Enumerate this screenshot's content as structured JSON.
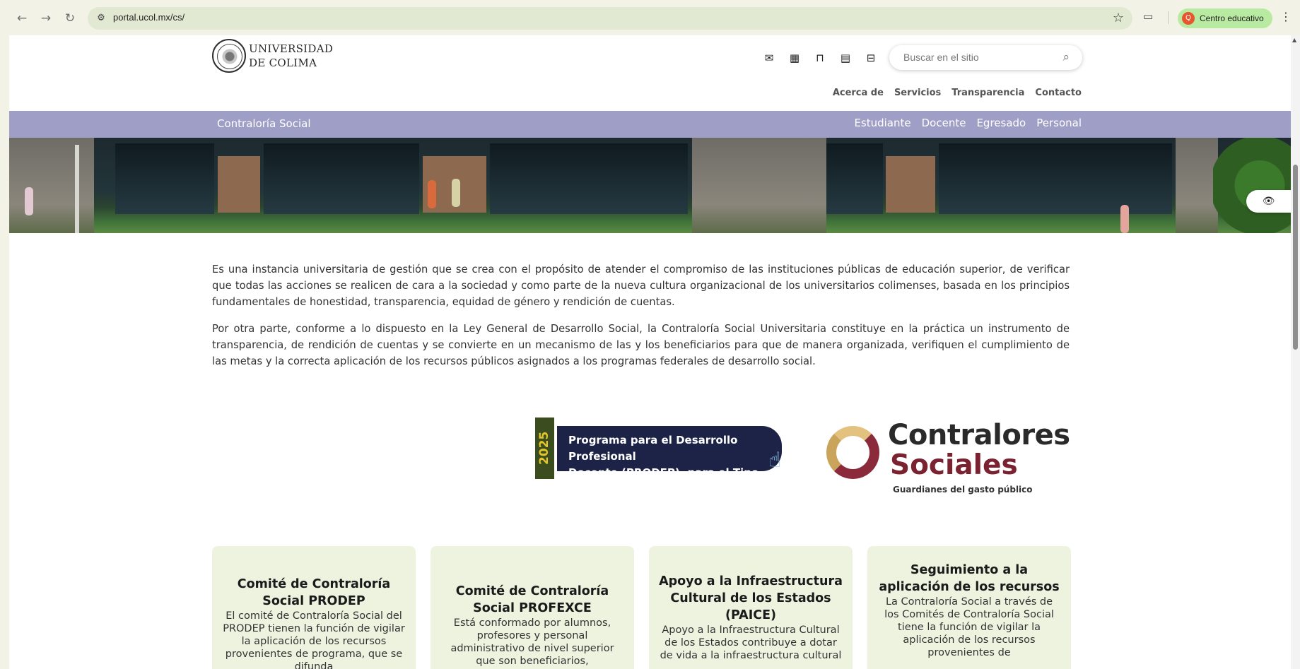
{
  "browser": {
    "url": "portal.ucol.mx/cs/",
    "profile_initial": "Q",
    "profile_label": "Centro educativo",
    "icons": [
      "back-arrow-icon",
      "forward-arrow-icon",
      "reload-icon",
      "site-settings-icon",
      "bookmark-star-icon",
      "cast-icon",
      "kebab-menu-icon"
    ]
  },
  "header": {
    "logo_line1": "UNIVERSIDAD",
    "logo_line2": "DE COLIMA",
    "quick_icons": [
      "mail-icon",
      "calendar-icon",
      "shopping-bag-icon",
      "news-icon",
      "briefcase-icon"
    ],
    "search_placeholder": "Buscar en el sitio",
    "top_menu": [
      "Acerca de",
      "Servicios",
      "Transparencia",
      "Contacto"
    ],
    "section_title": "Contraloría Social",
    "audience_menu": [
      "Estudiante",
      "Docente",
      "Egresado",
      "Personal"
    ],
    "band_color": "#9f9ec6"
  },
  "intro": {
    "paragraph1": "Es una instancia universitaria de gestión que se crea con el propósito de atender el compromiso de las instituciones públicas de educación superior, de verificar que todas las acciones se realicen de cara a la sociedad y como parte de la nueva cultura organizacional de los universitarios colimenses, basada en los principios fundamentales de honestidad, transparencia, equidad de género y rendición de cuentas.",
    "paragraph2": "Por otra parte, conforme a lo dispuesto en la Ley General de Desarrollo Social, la Contraloría Social Universitaria constituye en la práctica un instrumento de transparencia, de rendición de cuentas y se convierte en un mecanismo de las y los beneficiarios para que de manera organizada, verifiquen el cumplimiento de las metas y la correcta aplicación de los recursos públicos asignados a los programas federales de desarrollo social."
  },
  "banners": {
    "prodep_year": "2025",
    "prodep_line1": "Programa para el Desarrollo Profesional",
    "prodep_line2": "Docente (PRODEP), para el Tipo Superior",
    "contralores_line1": "Contralores",
    "contralores_line2": "Sociales",
    "contralores_tagline": "Guardianes del gasto público"
  },
  "cards": [
    {
      "title": "Comité de Contraloría Social PRODEP",
      "text": "El comité de Contraloría Social del PRODEP tienen la función de vigilar la aplicación de los recursos provenientes de programa, que se difunda"
    },
    {
      "title": "Comité de Contraloría Social PROFEXCE",
      "text": "Está conformado por alumnos, profesores y personal administrativo de nivel superior que son beneficiarios,"
    },
    {
      "title": "Apoyo a la Infraestructura Cultural de los Estados (PAICE)",
      "text": "Apoyo a la Infraestructura Cultural de los Estados contribuye a dotar de vida a la infraestructura cultural"
    },
    {
      "title": "Seguimiento a la aplicación de los recursos",
      "text": "La Contraloría Social a través de los Comités de Contraloría Social tiene la función de vigilar la aplicación de los recursos provenientes de"
    }
  ]
}
